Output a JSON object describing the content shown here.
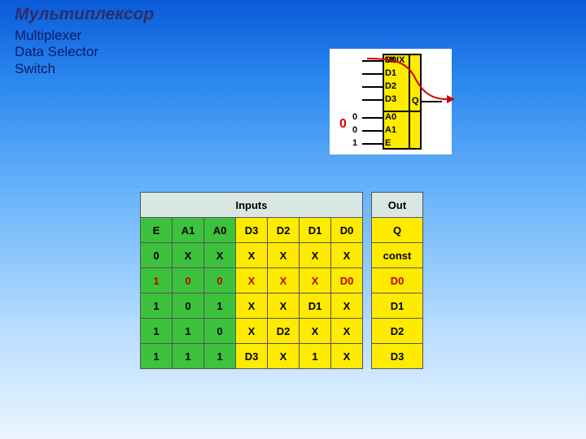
{
  "title": "Мультиплексор",
  "subtitle": "Multiplexer\nData Selector\nSwitch",
  "mux": {
    "label": "MUX",
    "out": "Q",
    "pins": [
      "D0",
      "D1",
      "D2",
      "D3",
      "A0",
      "A1",
      "E"
    ],
    "bits": [
      "0",
      "0",
      "1"
    ],
    "zero": "0"
  },
  "chart_data": {
    "type": "table",
    "title": "",
    "headers": {
      "inputs": "Inputs",
      "out": "Out",
      "cols": [
        "E",
        "A1",
        "A0",
        "D3",
        "D2",
        "D1",
        "D0",
        "Q"
      ]
    },
    "rows": [
      [
        "0",
        "X",
        "X",
        "X",
        "X",
        "X",
        "X",
        "const"
      ],
      [
        "1",
        "0",
        "0",
        "X",
        "X",
        "X",
        "D0",
        "D0"
      ],
      [
        "1",
        "0",
        "1",
        "X",
        "X",
        "D1",
        "X",
        "D1"
      ],
      [
        "1",
        "1",
        "0",
        "X",
        "D2",
        "X",
        "X",
        "D2"
      ],
      [
        "1",
        "1",
        "1",
        "D3",
        "X",
        "1",
        "X",
        "D3"
      ]
    ],
    "highlight_row_index": 1
  }
}
